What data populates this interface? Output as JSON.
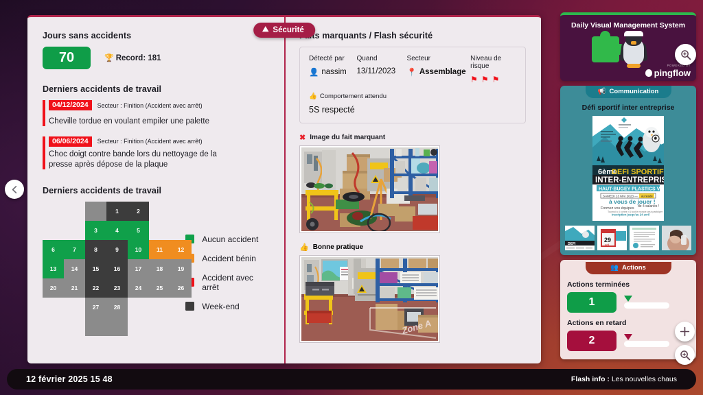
{
  "tab": {
    "label": "Sécurité",
    "icon": "helmet-icon"
  },
  "left": {
    "days_title": "Jours sans accidents",
    "days_value": "70",
    "record_label": "Record: 181",
    "recent_title": "Derniers accidents de travail",
    "accidents": [
      {
        "date": "04/12/2024",
        "sector": "Secteur : Finition (Accident avec arrêt)",
        "desc": "Cheville tordue en voulant empiler une palette"
      },
      {
        "date": "06/06/2024",
        "sector": "Secteur : Finition (Accident avec arrêt)",
        "desc": "Choc doigt contre bande lors du nettoyage de la presse après dépose de la plaque"
      }
    ],
    "calendar_title": "Derniers accidents de travail",
    "calendar": {
      "cells": [
        {
          "n": "",
          "col": 2,
          "row": 0,
          "status": "grey"
        },
        {
          "n": "1",
          "col": 3,
          "row": 0,
          "status": "dark"
        },
        {
          "n": "2",
          "col": 4,
          "row": 0,
          "status": "dark"
        },
        {
          "n": "3",
          "col": 2,
          "row": 1,
          "status": "green"
        },
        {
          "n": "4",
          "col": 3,
          "row": 1,
          "status": "green"
        },
        {
          "n": "5",
          "col": 4,
          "row": 1,
          "status": "green"
        },
        {
          "n": "6",
          "col": 0,
          "row": 2,
          "status": "green"
        },
        {
          "n": "7",
          "col": 1,
          "row": 2,
          "status": "green"
        },
        {
          "n": "8",
          "col": 2,
          "row": 2,
          "status": "dark"
        },
        {
          "n": "9",
          "col": 3,
          "row": 2,
          "status": "dark"
        },
        {
          "n": "10",
          "col": 4,
          "row": 2,
          "status": "green"
        },
        {
          "n": "11",
          "col": 5,
          "row": 2,
          "status": "orange"
        },
        {
          "n": "12",
          "col": 6,
          "row": 2,
          "status": "orange"
        },
        {
          "n": "13",
          "col": 0,
          "row": 3,
          "status": "green"
        },
        {
          "n": "14",
          "col": 1,
          "row": 3,
          "status": "grey"
        },
        {
          "n": "15",
          "col": 2,
          "row": 3,
          "status": "dark"
        },
        {
          "n": "16",
          "col": 3,
          "row": 3,
          "status": "dark"
        },
        {
          "n": "17",
          "col": 4,
          "row": 3,
          "status": "grey"
        },
        {
          "n": "18",
          "col": 5,
          "row": 3,
          "status": "grey"
        },
        {
          "n": "19",
          "col": 6,
          "row": 3,
          "status": "grey"
        },
        {
          "n": "20",
          "col": 0,
          "row": 4,
          "status": "grey"
        },
        {
          "n": "21",
          "col": 1,
          "row": 4,
          "status": "grey"
        },
        {
          "n": "22",
          "col": 2,
          "row": 4,
          "status": "dark"
        },
        {
          "n": "23",
          "col": 3,
          "row": 4,
          "status": "dark"
        },
        {
          "n": "24",
          "col": 4,
          "row": 4,
          "status": "grey"
        },
        {
          "n": "25",
          "col": 5,
          "row": 4,
          "status": "grey"
        },
        {
          "n": "26",
          "col": 6,
          "row": 4,
          "status": "grey"
        },
        {
          "n": "27",
          "col": 2,
          "row": 5,
          "status": "grey"
        },
        {
          "n": "28",
          "col": 3,
          "row": 5,
          "status": "grey"
        },
        {
          "n": "",
          "col": 2,
          "row": 6,
          "status": "grey"
        },
        {
          "n": "",
          "col": 3,
          "row": 6,
          "status": "grey"
        }
      ],
      "legend": [
        {
          "label": "Aucun accident",
          "color": "#10a04a"
        },
        {
          "label": "Accident bénin",
          "color": "#f08d20"
        },
        {
          "label": "Accident avec arrêt",
          "color": "#f0111a"
        },
        {
          "label": "Week-end",
          "color": "#3c3c3c"
        }
      ]
    }
  },
  "center": {
    "title": "Faits marquants / Flash sécurité",
    "fields": {
      "detected_by_label": "Détecté par",
      "detected_by_value": "nassim",
      "when_label": "Quand",
      "when_value": "13/11/2023",
      "sector_label": "Secteur",
      "sector_value": "Assemblage",
      "risk_label": "Niveau de risque",
      "risk_flags": 3
    },
    "behavior_label": "Comportement attendu",
    "behavior_value": "5S respecté",
    "image_bad_label": "Image du fait marquant",
    "image_good_label": "Bonne pratique"
  },
  "sidebar": {
    "dvms": {
      "title": "Daily Visual Management System",
      "powered_by": "POWERED BY",
      "brand": "pingflow"
    },
    "communication": {
      "pill": "Communication",
      "title": "Défi sportif inter entreprise",
      "poster": {
        "headline_1": "6ème DEFI SPORTIF",
        "headline_2": "INTER-ENTREPRISES",
        "headline_3": "HAUT-BUGEY PLASTICS VALLEE",
        "date_line": "SAMEDI 13 MAI 2023",
        "cta": "à vous de jouer !",
        "sub": "Formez vos équipes",
        "sub2": "de 4 salariés !",
        "deadline": "inscription jusqu'au 24 avril"
      }
    },
    "actions": {
      "pill": "Actions",
      "done_label": "Actions terminées",
      "done_value": "1",
      "late_label": "Actions en retard",
      "late_value": "2"
    }
  },
  "bottom": {
    "datetime": "12 février 2025 15 48",
    "flash_prefix": "Flash info :",
    "flash_text": " Les nouvelles chaus"
  }
}
